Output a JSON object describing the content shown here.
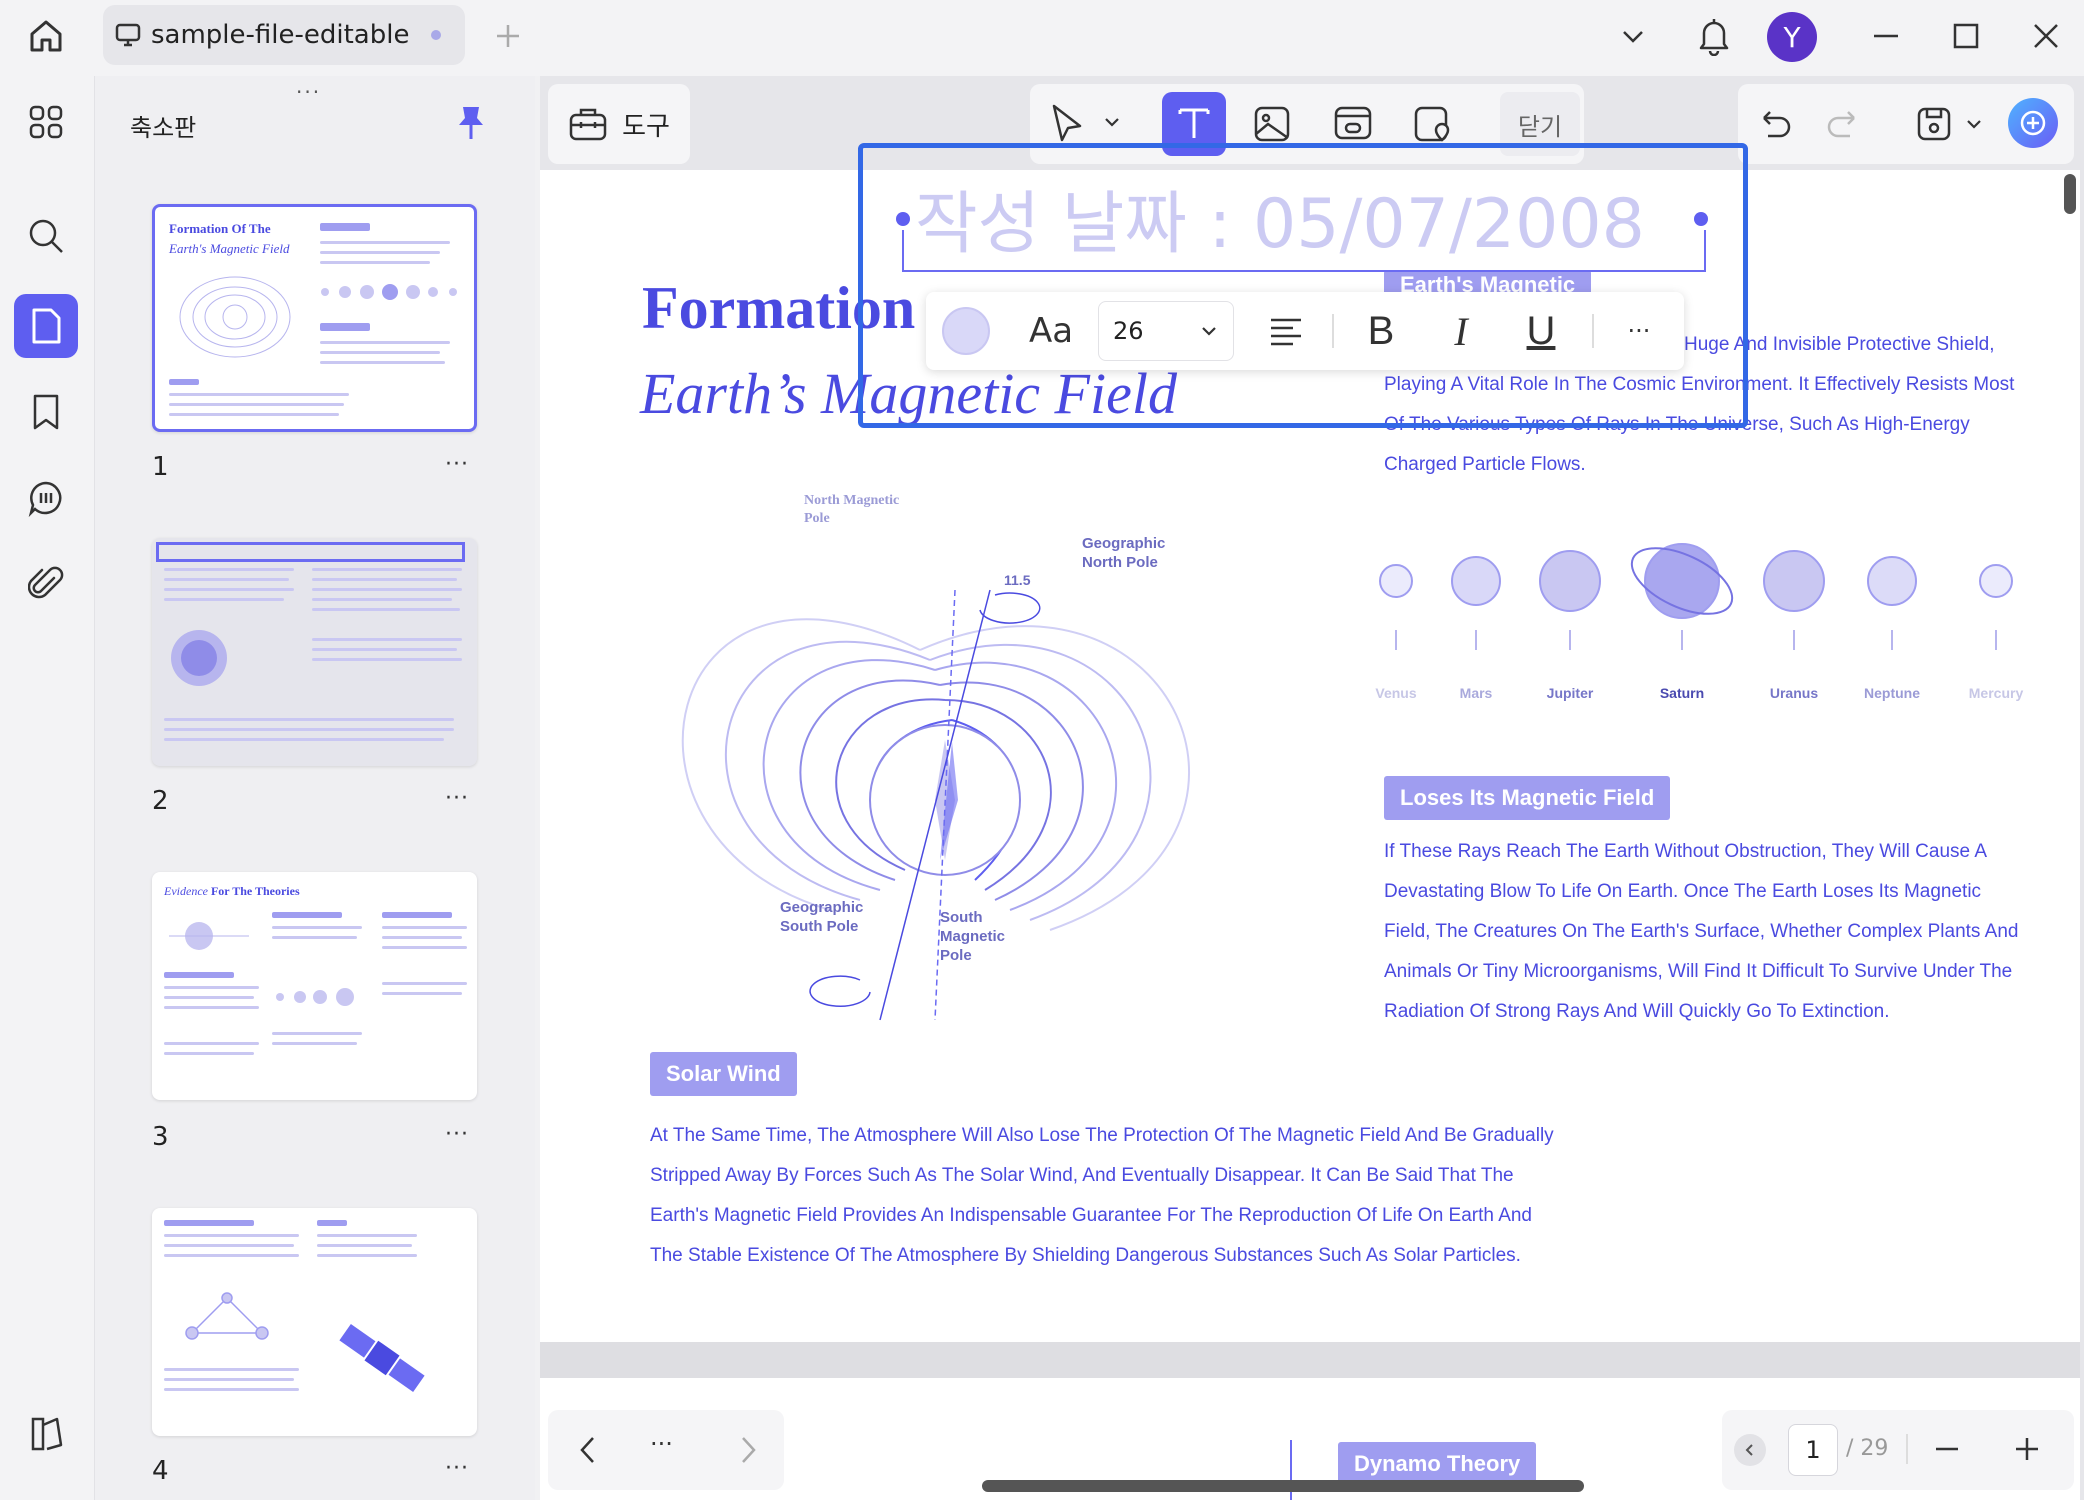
{
  "window": {
    "tab_title": "sample-file-editable",
    "avatar_letter": "Y"
  },
  "sidebar": {
    "panel_title": "축소판",
    "thumbnails": [
      {
        "number": "1",
        "more": "···"
      },
      {
        "number": "2",
        "more": "···"
      },
      {
        "number": "3",
        "more": "···"
      },
      {
        "number": "4",
        "more": "···"
      }
    ]
  },
  "toolbar": {
    "tools_label": "도구",
    "close_label": "닫기"
  },
  "format_toolbar": {
    "font_label": "Aa",
    "font_size": "26",
    "bold": "B",
    "italic": "I",
    "underline": "U",
    "more": "···"
  },
  "page": {
    "date_text": "작성 날짜 : 05/07/2008",
    "title_line1": "Formation",
    "title_line2": "Earth’s Magnetic Field",
    "hidden_badge": "Earth's Magnetic",
    "intro_lines": [
      "Huge And Invisible Protective Shield,",
      "Playing A Vital Role In The Cosmic Environment. It Effectively Resists Most",
      "Of The Various Types Of Rays In The Universe, Such As High-Energy",
      "Charged Particle Flows."
    ],
    "diagram_labels": {
      "north_magnetic": "North Magnetic Pole",
      "geo_north": "Geographic North Pole",
      "angle": "11.5",
      "geo_south": "Geographic South Pole",
      "south_magnetic": "South Magnetic Pole"
    },
    "planets": [
      "Venus",
      "Mars",
      "Jupiter",
      "Saturn",
      "Uranus",
      "Neptune",
      "Mercury"
    ],
    "section2_title": "Loses Its Magnetic Field",
    "section2_lines": [
      "If These Rays Reach The Earth Without Obstruction, They Will Cause A",
      "Devastating Blow To Life On Earth. Once The Earth Loses Its Magnetic",
      "Field, The Creatures On The Earth's Surface, Whether Complex Plants And",
      "Animals Or Tiny Microorganisms, Will Find It Difficult To Survive Under The",
      "Radiation Of Strong Rays And Will Quickly Go To Extinction."
    ],
    "section3_title": "Solar Wind",
    "section3_lines": [
      "At The Same Time, The Atmosphere Will Also Lose The Protection Of The Magnetic Field And Be Gradually",
      "Stripped Away By Forces Such As The Solar Wind, And Eventually Disappear. It Can Be Said That The",
      "Earth's Magnetic Field Provides An Indispensable Guarantee For The Reproduction Of Life On Earth And",
      "The Stable Existence Of The Atmosphere By Shielding Dangerous Substances Such As Solar Particles."
    ],
    "next_section_title": "Dynamo Theory"
  },
  "pagination": {
    "current": "1",
    "total": "/ 29",
    "more": "···"
  },
  "colors": {
    "accent": "#5e5ef0",
    "text_purple": "#4a4ae0",
    "badge": "#9f9df0",
    "edit_border": "#3368e6"
  }
}
